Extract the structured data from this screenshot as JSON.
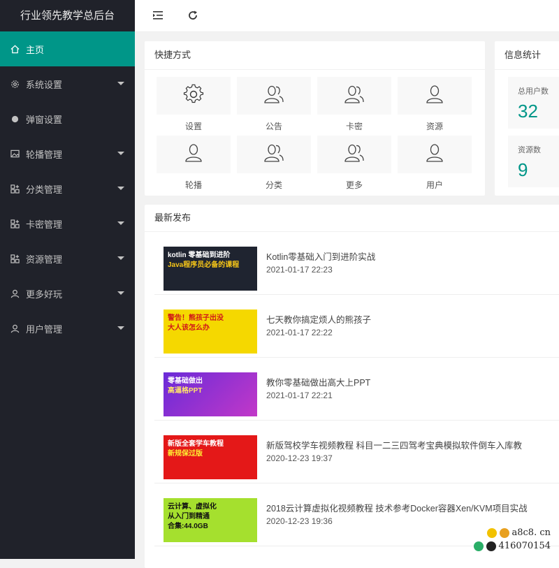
{
  "app": {
    "title": "行业领先教学总后台"
  },
  "sidebar": {
    "items": [
      {
        "label": "主页",
        "icon": "home-icon",
        "active": true,
        "arrow": false
      },
      {
        "label": "系统设置",
        "icon": "gear-icon",
        "active": false,
        "arrow": true
      },
      {
        "label": "弹窗设置",
        "icon": "circle-icon",
        "active": false,
        "arrow": false
      },
      {
        "label": "轮播管理",
        "icon": "image-icon",
        "active": false,
        "arrow": true
      },
      {
        "label": "分类管理",
        "icon": "apps-icon",
        "active": false,
        "arrow": true
      },
      {
        "label": "卡密管理",
        "icon": "apps-icon",
        "active": false,
        "arrow": true
      },
      {
        "label": "资源管理",
        "icon": "apps-icon",
        "active": false,
        "arrow": true
      },
      {
        "label": "更多好玩",
        "icon": "user-icon",
        "active": false,
        "arrow": true
      },
      {
        "label": "用户管理",
        "icon": "user-icon",
        "active": false,
        "arrow": true
      }
    ]
  },
  "topbar": {
    "collapse_icon": "menu-collapse-icon",
    "refresh_icon": "refresh-icon"
  },
  "shortcuts": {
    "title": "快捷方式",
    "items": [
      {
        "label": "设置",
        "icon": "gear-icon"
      },
      {
        "label": "公告",
        "icon": "users-icon"
      },
      {
        "label": "卡密",
        "icon": "users-icon"
      },
      {
        "label": "资源",
        "icon": "user-icon"
      },
      {
        "label": "轮播",
        "icon": "user-icon"
      },
      {
        "label": "分类",
        "icon": "users-icon"
      },
      {
        "label": "更多",
        "icon": "users-icon"
      },
      {
        "label": "用户",
        "icon": "user-icon"
      }
    ]
  },
  "stats": {
    "title": "信息统计",
    "items": [
      {
        "label": "总用户数",
        "value": "32"
      },
      {
        "label": "资源数",
        "value": "9"
      }
    ]
  },
  "posts": {
    "title": "最新发布",
    "items": [
      {
        "title": "Kotlin零基础入门到进阶实战",
        "date": "2021-01-17 22:23",
        "thumb": {
          "line1": "kotlin 零基础到进阶",
          "line2": "Java程序员必备的课程"
        }
      },
      {
        "title": "七天教你搞定烦人的熊孩子",
        "date": "2021-01-17 22:22",
        "thumb": {
          "line1": "警告！熊孩子出没",
          "line2": "大人该怎么办"
        }
      },
      {
        "title": "教你零基础做出高大上PPT",
        "date": "2021-01-17 22:21",
        "thumb": {
          "line1": "零基础做出",
          "line2": "高逼格PPT"
        }
      },
      {
        "title": "新版驾校学车视频教程 科目一二三四驾考宝典模拟软件倒车入库教",
        "date": "2020-12-23 19:37",
        "thumb": {
          "line1": "新版全套学车教程",
          "line2": "新规保过版"
        }
      },
      {
        "title": "2018云计算虚拟化视频教程 技术参考Docker容器Xen/KVM项目实战",
        "date": "2020-12-23 19:36",
        "thumb": {
          "line1": "云计算、虚拟化",
          "line2": "从入门到精通",
          "line3": "合集:44.0GB"
        }
      }
    ]
  },
  "watermark": {
    "site": "a8c8. cn",
    "qq": "416070154"
  },
  "colors": {
    "accent": "#009688",
    "sidebar": "#20222a"
  }
}
